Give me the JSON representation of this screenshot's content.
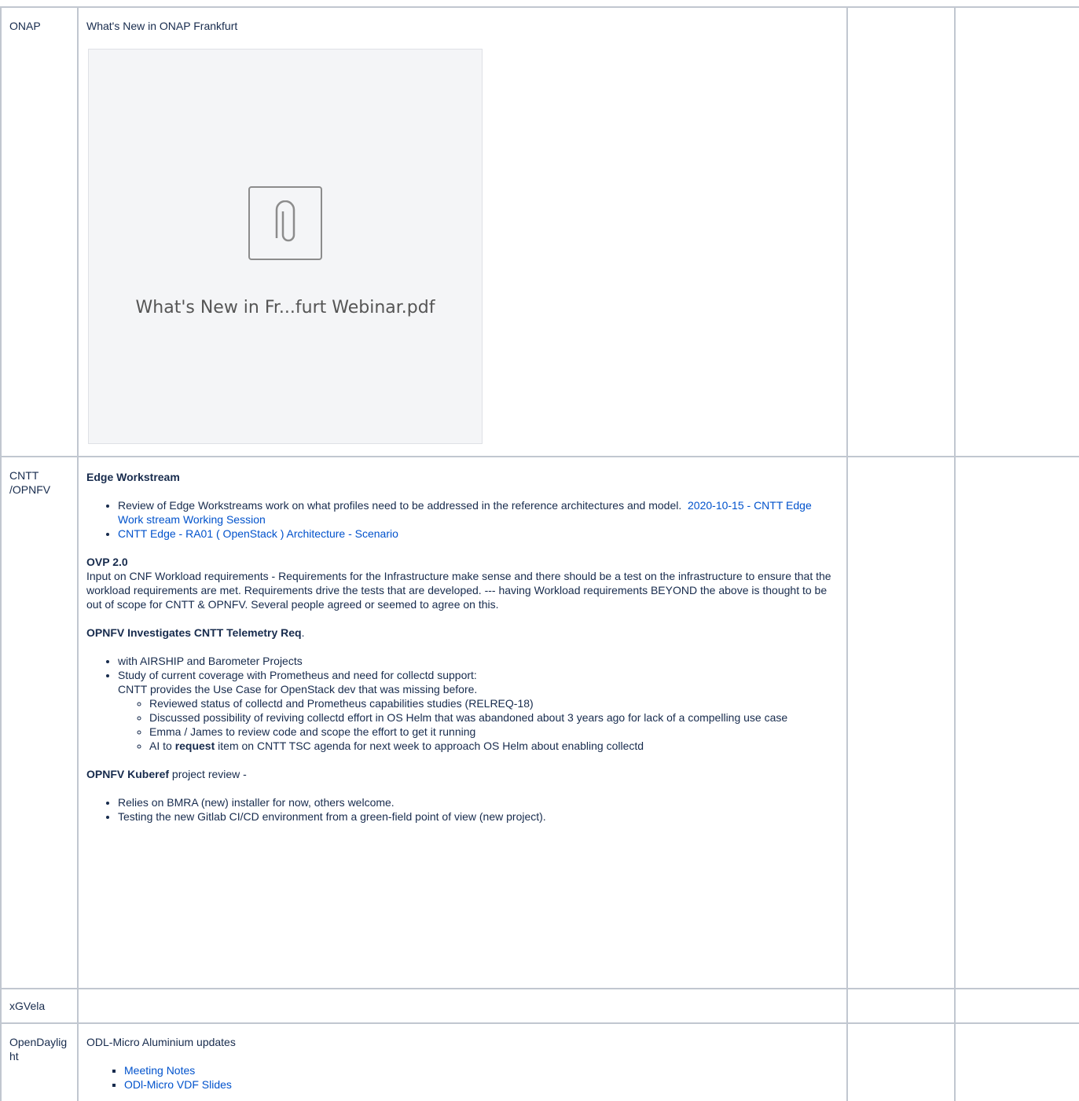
{
  "rows": {
    "onap": {
      "name": "ONAP",
      "title": "What's New in ONAP Frankfurt",
      "attachment": {
        "filename": "What's New in Fr...furt Webinar.pdf",
        "icon": "paperclip-icon"
      }
    },
    "cntt": {
      "name": "CNTT /OPNFV",
      "edge": {
        "heading": "Edge Workstream",
        "item1_text": "Review of Edge Workstreams work on what profiles need to be addressed in the reference architectures and model.",
        "item1_link": "2020-10-15 - CNTT Edge Work stream Working Session",
        "item2_link": "CNTT Edge - RA01 ( OpenStack ) Architecture - Scenario"
      },
      "ovp": {
        "heading": "OVP 2.0",
        "para": "Input on CNF Workload requirements - Requirements for the Infrastructure make sense and there should be a test on the infrastructure to ensure that the workload requirements are met. Requirements drive the tests that are developed. --- having Workload requirements BEYOND the above is thought to be out of scope for CNTT & OPNFV. Several people agreed or seemed to agree on this."
      },
      "telemetry": {
        "heading": "OPNFV Investigates CNTT Telemetry Req",
        "heading_suffix": ".",
        "item1": "with AIRSHIP and Barometer Projects",
        "item2_line1": "Study of current coverage with Prometheus and need for collectd support:",
        "item2_line2": "CNTT provides the Use Case for OpenStack dev that was missing before.",
        "sub1": "Reviewed status of collectd and Prometheus capabilities studies (RELREQ-18)",
        "sub2": "Discussed possibility of reviving collectd effort in OS Helm that was abandoned about 3 years ago for lack of a compelling use case",
        "sub3": "Emma / James to review code and scope the effort to get it running",
        "sub4_pre": "AI to ",
        "sub4_bold": "request",
        "sub4_post": " item on CNTT TSC agenda for next week to approach OS Helm about enabling collectd"
      },
      "kuberef": {
        "heading": "OPNFV Kuberef",
        "heading_suffix": " project review -",
        "item1": "Relies on BMRA (new) installer for now, others welcome.",
        "item2": "Testing the new Gitlab CI/CD environment from a green-field point of view (new project)."
      }
    },
    "xgvela": {
      "name": "xGVela"
    },
    "odl": {
      "name": "OpenDaylight",
      "title": "ODL-Micro Aluminium updates",
      "link1": "Meeting Notes",
      "link2": "ODl-Micro VDF Slides"
    }
  },
  "colors": {
    "link": "#0052cc",
    "border": "#c1c7d0",
    "text": "#172b4d"
  }
}
